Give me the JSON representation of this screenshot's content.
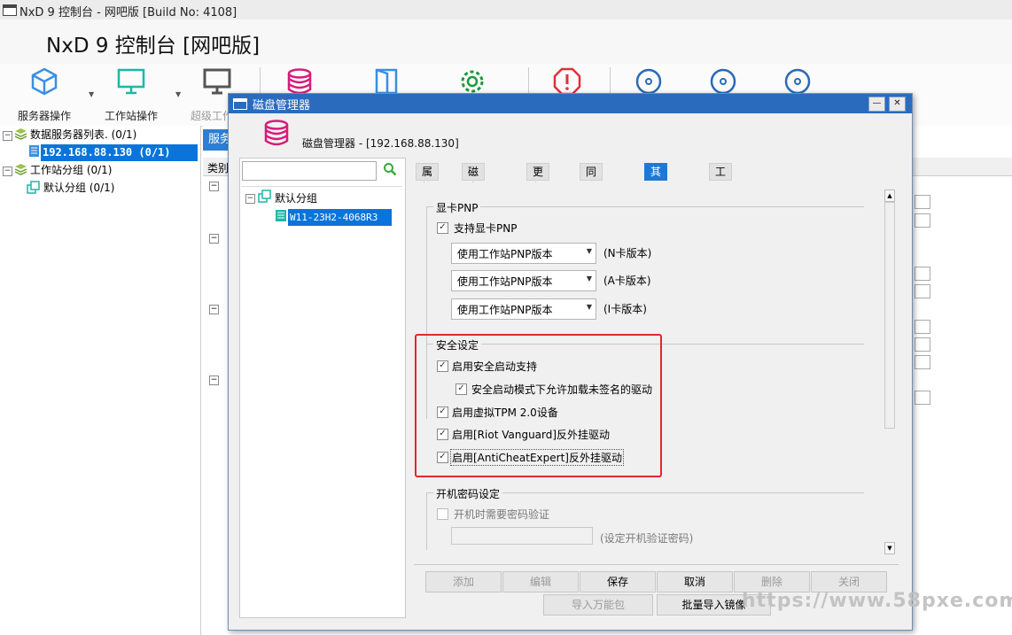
{
  "window": {
    "title": "NxD 9 控制台 - 网吧版 [Build No: 4108]"
  },
  "header": {
    "app_title": "NxD 9 控制台 [网吧版]"
  },
  "toolbar": {
    "items": [
      {
        "label": "服务器操作",
        "icon": "server-cube-icon",
        "color": "#3a8fe0"
      },
      {
        "label": "工作站操作",
        "icon": "monitor-icon",
        "color": "#1bb8a8"
      },
      {
        "label": "超级工作站",
        "icon": "monitor-dark-icon",
        "color": "#555555"
      },
      {
        "label": "",
        "icon": "database-icon",
        "color": "#d81b7a"
      },
      {
        "label": "",
        "icon": "door-icon",
        "color": "#3a8fe0"
      },
      {
        "label": "",
        "icon": "gear-icon",
        "color": "#1a9a3a"
      },
      {
        "label": "",
        "icon": "alert-icon",
        "color": "#e0303a"
      },
      {
        "label": "",
        "icon": "disc-icon",
        "color": "#2a6ab8"
      },
      {
        "label": "",
        "icon": "disc-icon",
        "color": "#2a6ab8"
      },
      {
        "label": "",
        "icon": "disc-icon",
        "color": "#2a6ab8"
      }
    ]
  },
  "left_tree": {
    "data_servers": "数据服务器列表. (0/1)",
    "server_ip": "192.168.88.130 (0/1)",
    "workstation_groups": "工作站分组 (0/1)",
    "default_group": "默认分组 (0/1)"
  },
  "background": {
    "tab_label": "服务",
    "column_label": "类别"
  },
  "dialog": {
    "title": "磁盘管理器",
    "header_text": "磁盘管理器 - [192.168.88.130]",
    "tree": {
      "group": "默认分组",
      "machine": "W11-23H2-4068R3"
    },
    "tabs": [
      "属性",
      "磁盘分区",
      "更新点",
      "同步设定",
      "其他设定",
      "工具"
    ],
    "active_tab": "其他设定",
    "pnp": {
      "legend": "显卡PNP",
      "support_label": "支持显卡PNP",
      "support_checked": true,
      "dropdowns": [
        {
          "value": "使用工作站PNP版本",
          "note": "(N卡版本)"
        },
        {
          "value": "使用工作站PNP版本",
          "note": "(A卡版本)"
        },
        {
          "value": "使用工作站PNP版本",
          "note": "(I卡版本)"
        }
      ]
    },
    "security": {
      "legend": "安全设定",
      "items": [
        {
          "label": "启用安全启动支持",
          "checked": true
        },
        {
          "label": "安全启动模式下允许加载未签名的驱动",
          "checked": true
        },
        {
          "label": "启用虚拟TPM 2.0设备",
          "checked": true
        },
        {
          "label": "启用[Riot Vanguard]反外挂驱动",
          "checked": true
        },
        {
          "label": "启用[AntiCheatExpert]反外挂驱动",
          "checked": true
        }
      ],
      "highlight_color": "#e5262a"
    },
    "boot_password": {
      "legend": "开机密码设定",
      "require_label": "开机时需要密码验证",
      "require_checked": false,
      "note": "(设定开机验证密码)"
    },
    "buttons": {
      "add": "添加",
      "edit": "编辑",
      "save": "保存",
      "cancel": "取消",
      "delete": "删除",
      "close": "关闭",
      "import_wanneng": "导入万能包",
      "batch_import": "批量导入镜像"
    },
    "close_glyph": "✕",
    "min_glyph": "—",
    "scroll_up": "▲",
    "scroll_down": "▼",
    "check_glyph": "✓",
    "dropdown_glyph": "▼"
  },
  "watermark": "https://www.58pxe.com"
}
